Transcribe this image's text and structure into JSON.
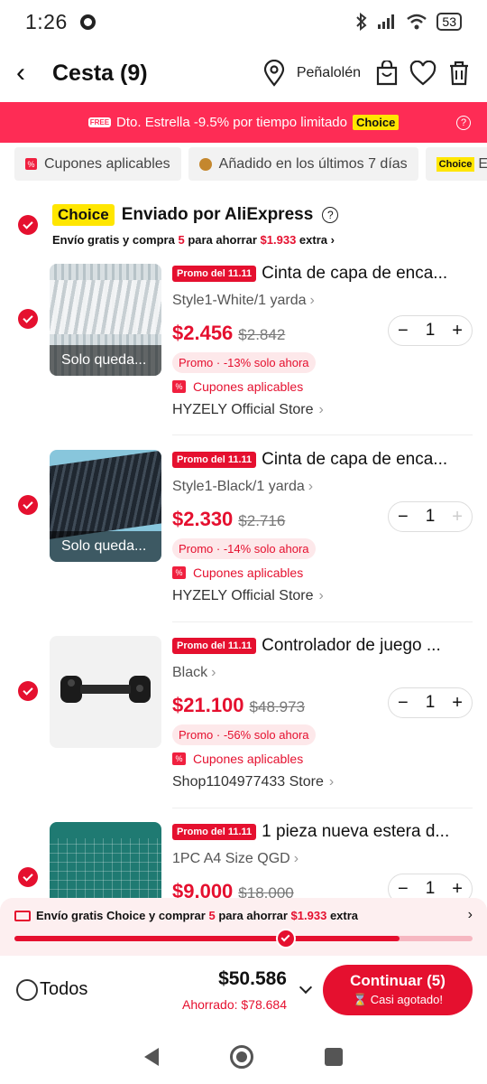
{
  "status": {
    "time": "1:26",
    "battery": "53"
  },
  "header": {
    "title": "Cesta (9)",
    "location": "Peñalolén"
  },
  "banner": {
    "free_label": "FREE",
    "text": "Dto. Estrella -9.5% por tiempo limitado",
    "choice": "Choice",
    "info": "?"
  },
  "filters": [
    {
      "label": "Cupones aplicables"
    },
    {
      "label": "Añadido en los últimos 7 días"
    },
    {
      "label": "Choice",
      "suffix": "E"
    }
  ],
  "store": {
    "choice": "Choice",
    "name": "Enviado por AliExpress",
    "help": "?",
    "shipping_pre": "Envío gratis y compra",
    "shipping_count": "5",
    "shipping_mid": "para ahorrar",
    "shipping_amount": "$1.933",
    "shipping_post": "extra"
  },
  "items": [
    {
      "promo": "Promo del 11.11",
      "title": "Cinta de capa de enca...",
      "variant": "Style1-White/1 yarda",
      "price": "$2.456",
      "old_price": "$2.842",
      "discount": "Promo · -13% solo ahora",
      "coupon": "Cupones aplicables",
      "seller": "HYZELY Official Store",
      "qty": "1",
      "overlay": "Solo queda..."
    },
    {
      "promo": "Promo del 11.11",
      "title": "Cinta de capa de enca...",
      "variant": "Style1-Black/1 yarda",
      "price": "$2.330",
      "old_price": "$2.716",
      "discount": "Promo · -14% solo ahora",
      "coupon": "Cupones aplicables",
      "seller": "HYZELY Official Store",
      "qty": "1",
      "overlay": "Solo queda..."
    },
    {
      "promo": "Promo del 11.11",
      "title": "Controlador de juego ...",
      "variant": "Black",
      "price": "$21.100",
      "old_price": "$48.973",
      "discount": "Promo · -56% solo ahora",
      "coupon": "Cupones aplicables",
      "seller": "Shop1104977433 Store",
      "qty": "1"
    },
    {
      "promo": "Promo del 11.11",
      "title": "1 pieza nueva estera d...",
      "variant": "1PC A4 Size QGD",
      "price": "$9.000",
      "old_price": "$18.000",
      "qty": "1"
    }
  ],
  "ship_bar": {
    "pre": "Envío gratis Choice y comprar",
    "count": "5",
    "mid": "para ahorrar",
    "amount": "$1.933",
    "post": "extra",
    "progress": 0.84
  },
  "footer": {
    "all_label": "Todos",
    "total": "$50.586",
    "saved": "Ahorrado: $78.684",
    "cta": "Continuar (5)",
    "cta_sub": "Casi agotado!"
  },
  "colors": {
    "accent": "#e5102f",
    "banner": "#fe2c55",
    "choice": "#ffe600"
  }
}
